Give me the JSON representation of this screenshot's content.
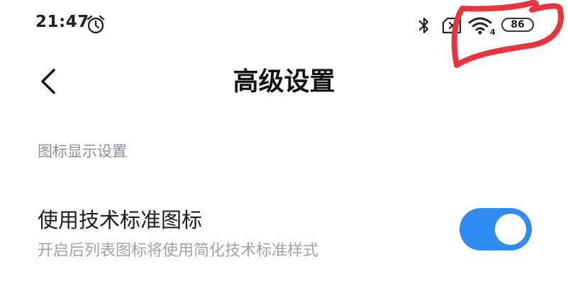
{
  "status_bar": {
    "time": "21:47",
    "battery_level": "86",
    "icons": [
      "alarm-icon",
      "bluetooth-icon",
      "no-sim-icon",
      "wifi-icon",
      "battery-icon"
    ],
    "wifi_standard_label": "4"
  },
  "header": {
    "title": "高级设置",
    "back_icon": "chevron-left-icon"
  },
  "section": {
    "header": "图标显示设置"
  },
  "setting": {
    "title": "使用技术标准图标",
    "description": "开启后列表图标将使用简化技术标准样式",
    "enabled": true
  },
  "colors": {
    "accent": "#2f8cf0",
    "section_header": "#8a8f9c",
    "description": "#a3a3a3",
    "annotation": "#e8343f"
  }
}
